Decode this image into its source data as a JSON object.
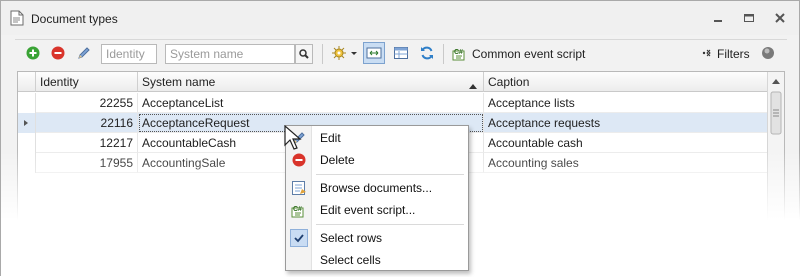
{
  "window": {
    "title": "Document types"
  },
  "toolbar": {
    "identity_placeholder": "Identity",
    "system_name_placeholder": "System name",
    "common_event_script": "Common event script",
    "filters": "Filters"
  },
  "grid": {
    "columns": [
      "Identity",
      "System name",
      "Caption"
    ],
    "rows": [
      {
        "identity": "22255",
        "system_name": "AcceptanceList",
        "caption": "Acceptance lists"
      },
      {
        "identity": "22116",
        "system_name": "AcceptanceRequest",
        "caption": "Acceptance requests"
      },
      {
        "identity": "12217",
        "system_name": "AccountableCash",
        "caption": "Accountable cash"
      },
      {
        "identity": "17955",
        "system_name": "AccountingSale",
        "caption": "Accounting sales"
      }
    ],
    "selected_row_index": 1,
    "sort_column": "System name",
    "sort_direction": "ascending"
  },
  "context_menu": {
    "items": [
      {
        "label": "Edit",
        "icon": "pencil-icon"
      },
      {
        "label": "Delete",
        "icon": "delete-icon"
      },
      {
        "label": "Browse documents...",
        "icon": "browse-documents-icon"
      },
      {
        "label": "Edit event script...",
        "icon": "event-script-icon"
      },
      {
        "label": "Select rows",
        "icon": "check-icon",
        "checked": true
      },
      {
        "label": "Select cells",
        "icon": "",
        "checked": false
      }
    ]
  },
  "colors": {
    "selection": "#dde8f5",
    "add_green": "#3aa335",
    "delete_red": "#d9342b"
  }
}
